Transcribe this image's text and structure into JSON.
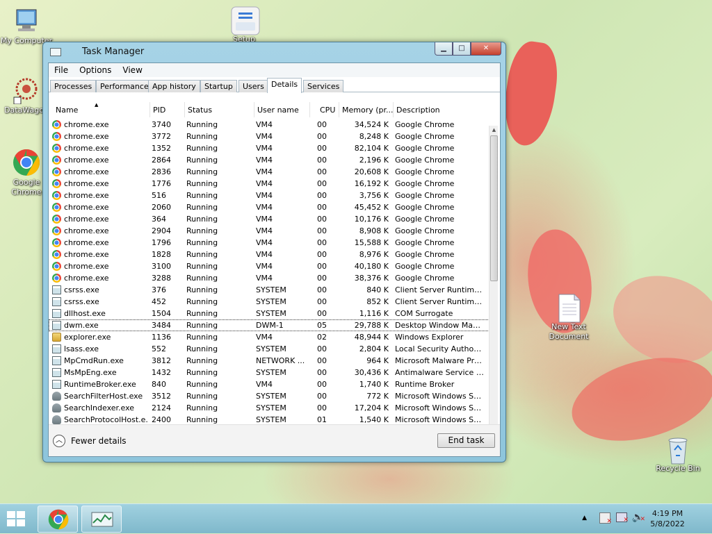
{
  "desktop": {
    "icons": [
      {
        "label": "My Computer",
        "icon": "computer-icon"
      },
      {
        "label": "DataWagon",
        "icon": "datawagon-icon"
      },
      {
        "label": "Google Chrome",
        "icon": "chrome-icon"
      },
      {
        "label": "Setup",
        "icon": "setup-icon"
      },
      {
        "label": "New Text Document",
        "icon": "text-document-icon"
      },
      {
        "label": "Recycle Bin",
        "icon": "recycle-bin-icon"
      }
    ]
  },
  "window": {
    "title": "Task Manager",
    "menu": [
      "File",
      "Options",
      "View"
    ],
    "tabs": [
      "Processes",
      "Performance",
      "App history",
      "Startup",
      "Users",
      "Details",
      "Services"
    ],
    "active_tab": "Details",
    "columns": [
      "Name",
      "PID",
      "Status",
      "User name",
      "CPU",
      "Memory (pr...",
      "Description"
    ],
    "rows": [
      {
        "icon": "chrome",
        "name": "chrome.exe",
        "pid": "3740",
        "status": "Running",
        "user": "VM4",
        "cpu": "00",
        "mem": "34,524 K",
        "desc": "Google Chrome"
      },
      {
        "icon": "chrome",
        "name": "chrome.exe",
        "pid": "3772",
        "status": "Running",
        "user": "VM4",
        "cpu": "00",
        "mem": "8,248 K",
        "desc": "Google Chrome"
      },
      {
        "icon": "chrome",
        "name": "chrome.exe",
        "pid": "1352",
        "status": "Running",
        "user": "VM4",
        "cpu": "00",
        "mem": "82,104 K",
        "desc": "Google Chrome"
      },
      {
        "icon": "chrome",
        "name": "chrome.exe",
        "pid": "2864",
        "status": "Running",
        "user": "VM4",
        "cpu": "00",
        "mem": "2,196 K",
        "desc": "Google Chrome"
      },
      {
        "icon": "chrome",
        "name": "chrome.exe",
        "pid": "2836",
        "status": "Running",
        "user": "VM4",
        "cpu": "00",
        "mem": "20,608 K",
        "desc": "Google Chrome"
      },
      {
        "icon": "chrome",
        "name": "chrome.exe",
        "pid": "1776",
        "status": "Running",
        "user": "VM4",
        "cpu": "00",
        "mem": "16,192 K",
        "desc": "Google Chrome"
      },
      {
        "icon": "chrome",
        "name": "chrome.exe",
        "pid": "516",
        "status": "Running",
        "user": "VM4",
        "cpu": "00",
        "mem": "3,756 K",
        "desc": "Google Chrome"
      },
      {
        "icon": "chrome",
        "name": "chrome.exe",
        "pid": "2060",
        "status": "Running",
        "user": "VM4",
        "cpu": "00",
        "mem": "45,452 K",
        "desc": "Google Chrome"
      },
      {
        "icon": "chrome",
        "name": "chrome.exe",
        "pid": "364",
        "status": "Running",
        "user": "VM4",
        "cpu": "00",
        "mem": "10,176 K",
        "desc": "Google Chrome"
      },
      {
        "icon": "chrome",
        "name": "chrome.exe",
        "pid": "2904",
        "status": "Running",
        "user": "VM4",
        "cpu": "00",
        "mem": "8,908 K",
        "desc": "Google Chrome"
      },
      {
        "icon": "chrome",
        "name": "chrome.exe",
        "pid": "1796",
        "status": "Running",
        "user": "VM4",
        "cpu": "00",
        "mem": "15,588 K",
        "desc": "Google Chrome"
      },
      {
        "icon": "chrome",
        "name": "chrome.exe",
        "pid": "1828",
        "status": "Running",
        "user": "VM4",
        "cpu": "00",
        "mem": "8,976 K",
        "desc": "Google Chrome"
      },
      {
        "icon": "chrome",
        "name": "chrome.exe",
        "pid": "3100",
        "status": "Running",
        "user": "VM4",
        "cpu": "00",
        "mem": "40,180 K",
        "desc": "Google Chrome"
      },
      {
        "icon": "chrome",
        "name": "chrome.exe",
        "pid": "3288",
        "status": "Running",
        "user": "VM4",
        "cpu": "00",
        "mem": "38,376 K",
        "desc": "Google Chrome"
      },
      {
        "icon": "app",
        "name": "csrss.exe",
        "pid": "376",
        "status": "Running",
        "user": "SYSTEM",
        "cpu": "00",
        "mem": "840 K",
        "desc": "Client Server Runtime ..."
      },
      {
        "icon": "app",
        "name": "csrss.exe",
        "pid": "452",
        "status": "Running",
        "user": "SYSTEM",
        "cpu": "00",
        "mem": "852 K",
        "desc": "Client Server Runtime ..."
      },
      {
        "icon": "app",
        "name": "dllhost.exe",
        "pid": "1504",
        "status": "Running",
        "user": "SYSTEM",
        "cpu": "00",
        "mem": "1,116 K",
        "desc": "COM Surrogate"
      },
      {
        "icon": "app",
        "name": "dwm.exe",
        "pid": "3484",
        "status": "Running",
        "user": "DWM-1",
        "cpu": "05",
        "mem": "29,788 K",
        "desc": "Desktop Window Man..."
      },
      {
        "icon": "folder",
        "name": "explorer.exe",
        "pid": "1136",
        "status": "Running",
        "user": "VM4",
        "cpu": "02",
        "mem": "48,944 K",
        "desc": "Windows Explorer"
      },
      {
        "icon": "app",
        "name": "lsass.exe",
        "pid": "552",
        "status": "Running",
        "user": "SYSTEM",
        "cpu": "00",
        "mem": "2,804 K",
        "desc": "Local Security Authorit..."
      },
      {
        "icon": "app",
        "name": "MpCmdRun.exe",
        "pid": "3812",
        "status": "Running",
        "user": "NETWORK ...",
        "cpu": "00",
        "mem": "964 K",
        "desc": "Microsoft Malware Pro..."
      },
      {
        "icon": "app",
        "name": "MsMpEng.exe",
        "pid": "1432",
        "status": "Running",
        "user": "SYSTEM",
        "cpu": "00",
        "mem": "30,436 K",
        "desc": "Antimalware Service Ex..."
      },
      {
        "icon": "app",
        "name": "RuntimeBroker.exe",
        "pid": "840",
        "status": "Running",
        "user": "VM4",
        "cpu": "00",
        "mem": "1,740 K",
        "desc": "Runtime Broker"
      },
      {
        "icon": "user",
        "name": "SearchFilterHost.exe",
        "pid": "3512",
        "status": "Running",
        "user": "SYSTEM",
        "cpu": "00",
        "mem": "772 K",
        "desc": "Microsoft Windows Se..."
      },
      {
        "icon": "user",
        "name": "SearchIndexer.exe",
        "pid": "2124",
        "status": "Running",
        "user": "SYSTEM",
        "cpu": "00",
        "mem": "17,204 K",
        "desc": "Microsoft Windows Se..."
      },
      {
        "icon": "user",
        "name": "SearchProtocolHost.e...",
        "pid": "2400",
        "status": "Running",
        "user": "SYSTEM",
        "cpu": "01",
        "mem": "1,540 K",
        "desc": "Microsoft Windows Se..."
      }
    ],
    "selected_row": "dwm.exe",
    "fewer_details": "Fewer details",
    "end_task": "End task"
  },
  "taskbar": {
    "time": "4:19 PM",
    "date": "5/8/2022"
  }
}
